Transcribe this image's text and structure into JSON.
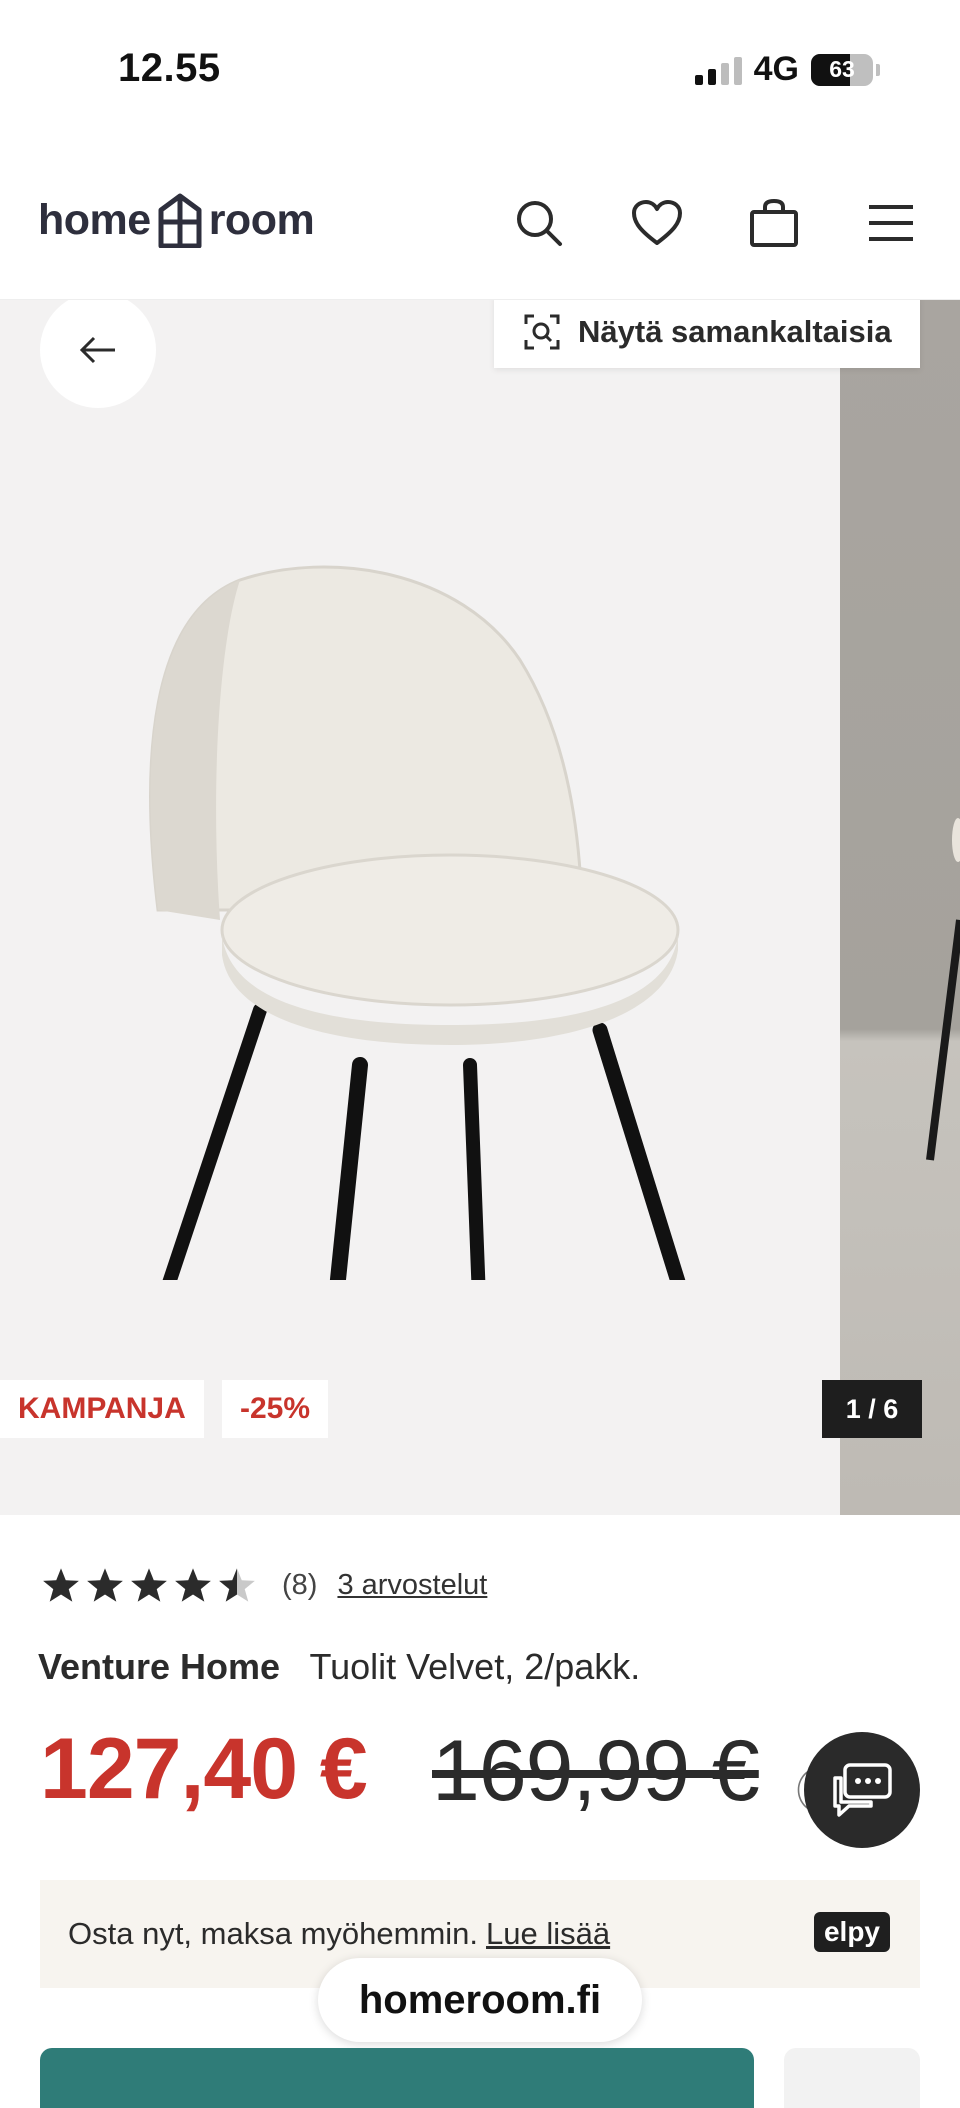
{
  "status_bar": {
    "time": "12.55",
    "network": "4G",
    "battery": "63",
    "battery_level": 0.63
  },
  "header": {
    "logo_left": "home",
    "logo_right": "room",
    "icons": [
      "search-icon",
      "heart-icon",
      "bag-icon",
      "menu-icon"
    ]
  },
  "gallery": {
    "similar_label": "Näytä samankaltaisia",
    "badge_campaign": "KAMPANJA",
    "badge_discount": "-25%",
    "counter": "1 / 6"
  },
  "product": {
    "rating_value": 4.5,
    "rating_count": "(8)",
    "reviews_link": "3 arvostelut",
    "brand": "Venture Home",
    "name": "Tuolit Velvet, 2/pakk.",
    "price": "127,40 €",
    "old_price": "169,99 €"
  },
  "bnpl": {
    "text": "Osta nyt, maksa myöhemmin.",
    "link": "Lue lisää",
    "provider": "elpy"
  },
  "browser": {
    "url": "homeroom.fi"
  },
  "colors": {
    "accent_red": "#c8342c",
    "cta_teal": "#2f7c78",
    "logo_navy": "#2e2f3d"
  }
}
